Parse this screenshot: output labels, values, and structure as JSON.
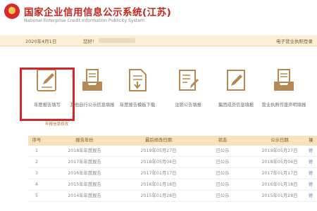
{
  "header": {
    "title": "国家企业信用信息公示系统(江苏)",
    "subtitle": "National Enterprise Credit Information Publicity System"
  },
  "infobar": {
    "date": "2020年4月1日",
    "company_label": "您好!",
    "right_text": "电子营业执照登录"
  },
  "functions": [
    {
      "label": "年度报告填写",
      "icon": "pencil-document-icon"
    },
    {
      "label": "其他自行公示信息填报",
      "icon": "inbox-document-icon"
    },
    {
      "label": "年度报告模板下载",
      "icon": "document-download-icon"
    },
    {
      "label": "注销公告填报",
      "icon": "document-pencil-icon"
    },
    {
      "label": "集团成员信息填报",
      "icon": "document-pencil-icon"
    },
    {
      "label": "营业执照作废声明填报",
      "icon": "inbox-document-icon"
    }
  ],
  "sub_link": "年报信息修改",
  "table": {
    "headers": [
      "序号",
      "报告年份",
      "最后修改日期",
      "状态",
      "公示日期",
      "操"
    ],
    "rows": [
      [
        "1",
        "2018年年度报告",
        "2019年05月27日",
        "已公示",
        "2019年05月27日",
        "修"
      ],
      [
        "2",
        "2017年年度报告",
        "2018年05月04日",
        "已公示",
        "2018年05月04日",
        "修"
      ],
      [
        "3",
        "2016年年度报告",
        "2017年01月17日",
        "已公示",
        "2017年01月17日",
        "修"
      ],
      [
        "4",
        "2015年年度报告",
        "2016年01月18日",
        "已公示",
        "2016年01月18日",
        "修"
      ],
      [
        "5",
        "2014年年度报告",
        "2015年01月28日",
        "已公示",
        "2015年01月28日",
        "修"
      ]
    ]
  },
  "colors": {
    "brand_red": "#c2261d",
    "highlight": "#d3262a",
    "header_bar": "#f6e3bd",
    "icon_brown": "#b58a52"
  }
}
